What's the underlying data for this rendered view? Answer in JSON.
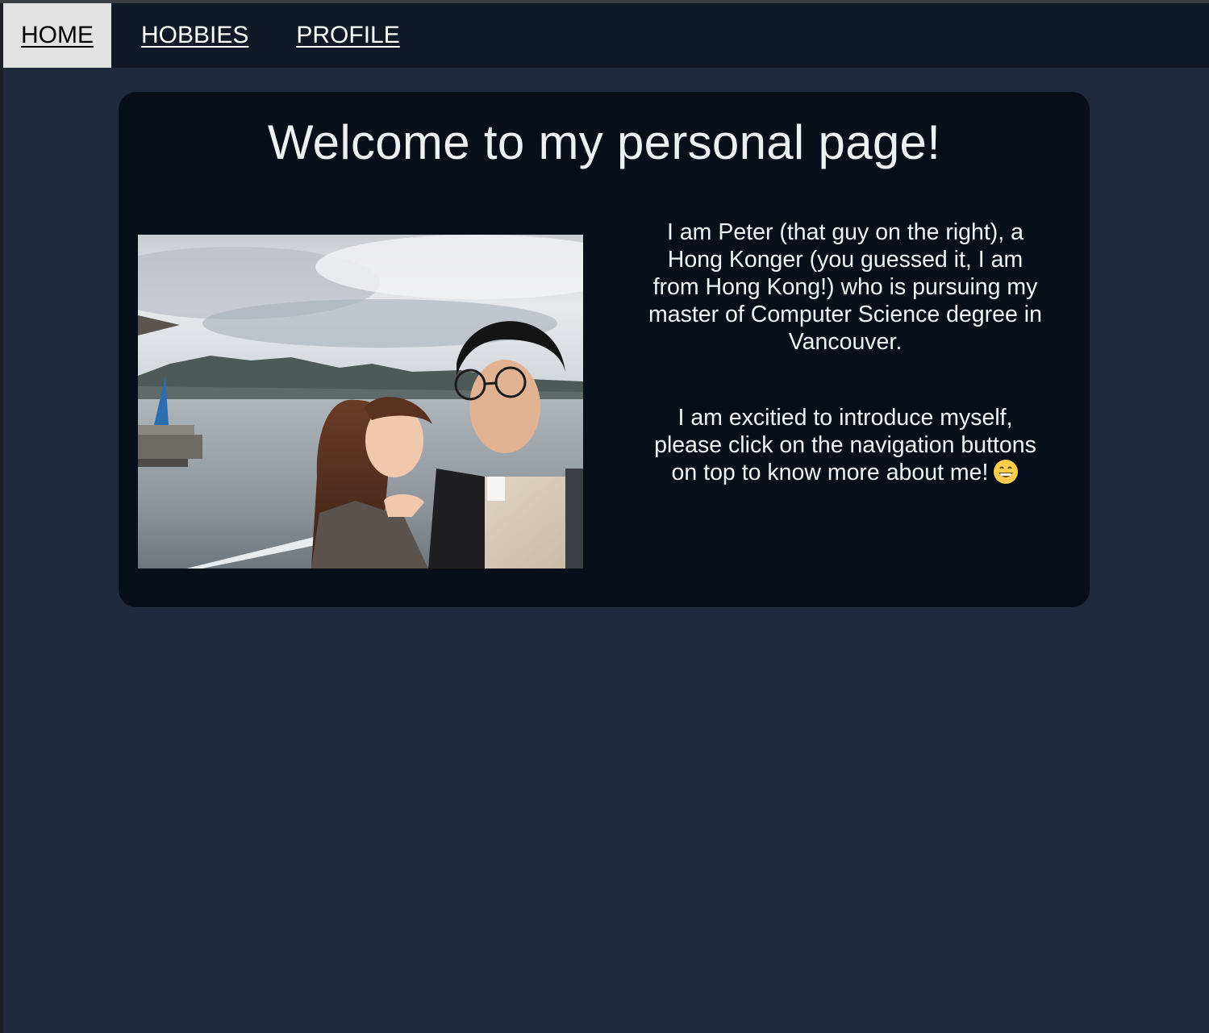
{
  "nav": {
    "items": [
      {
        "label": "HOME",
        "active": true
      },
      {
        "label": "HOBBIES",
        "active": false
      },
      {
        "label": "PROFILE",
        "active": false
      }
    ]
  },
  "main": {
    "title": "Welcome to my personal page!",
    "photo_description": "Selfie of a couple by the waterfront in Vancouver with mountains behind",
    "paragraph_1": "I am Peter (that guy on the right), a Hong Konger (you guessed it, I am from Hong Kong!) who is pursuing my master of Computer Science degree in Vancouver.",
    "paragraph_2": "I am excitied to introduce myself, please click on the navigation buttons on top to know more about me!",
    "emoji_icon": "grinning-face-icon"
  },
  "colors": {
    "page_background": "#1f2a3c",
    "navbar_background": "#111827",
    "active_nav_background": "#e2e2e2",
    "card_background": "#080e1a",
    "text": "#f1f3f6"
  }
}
